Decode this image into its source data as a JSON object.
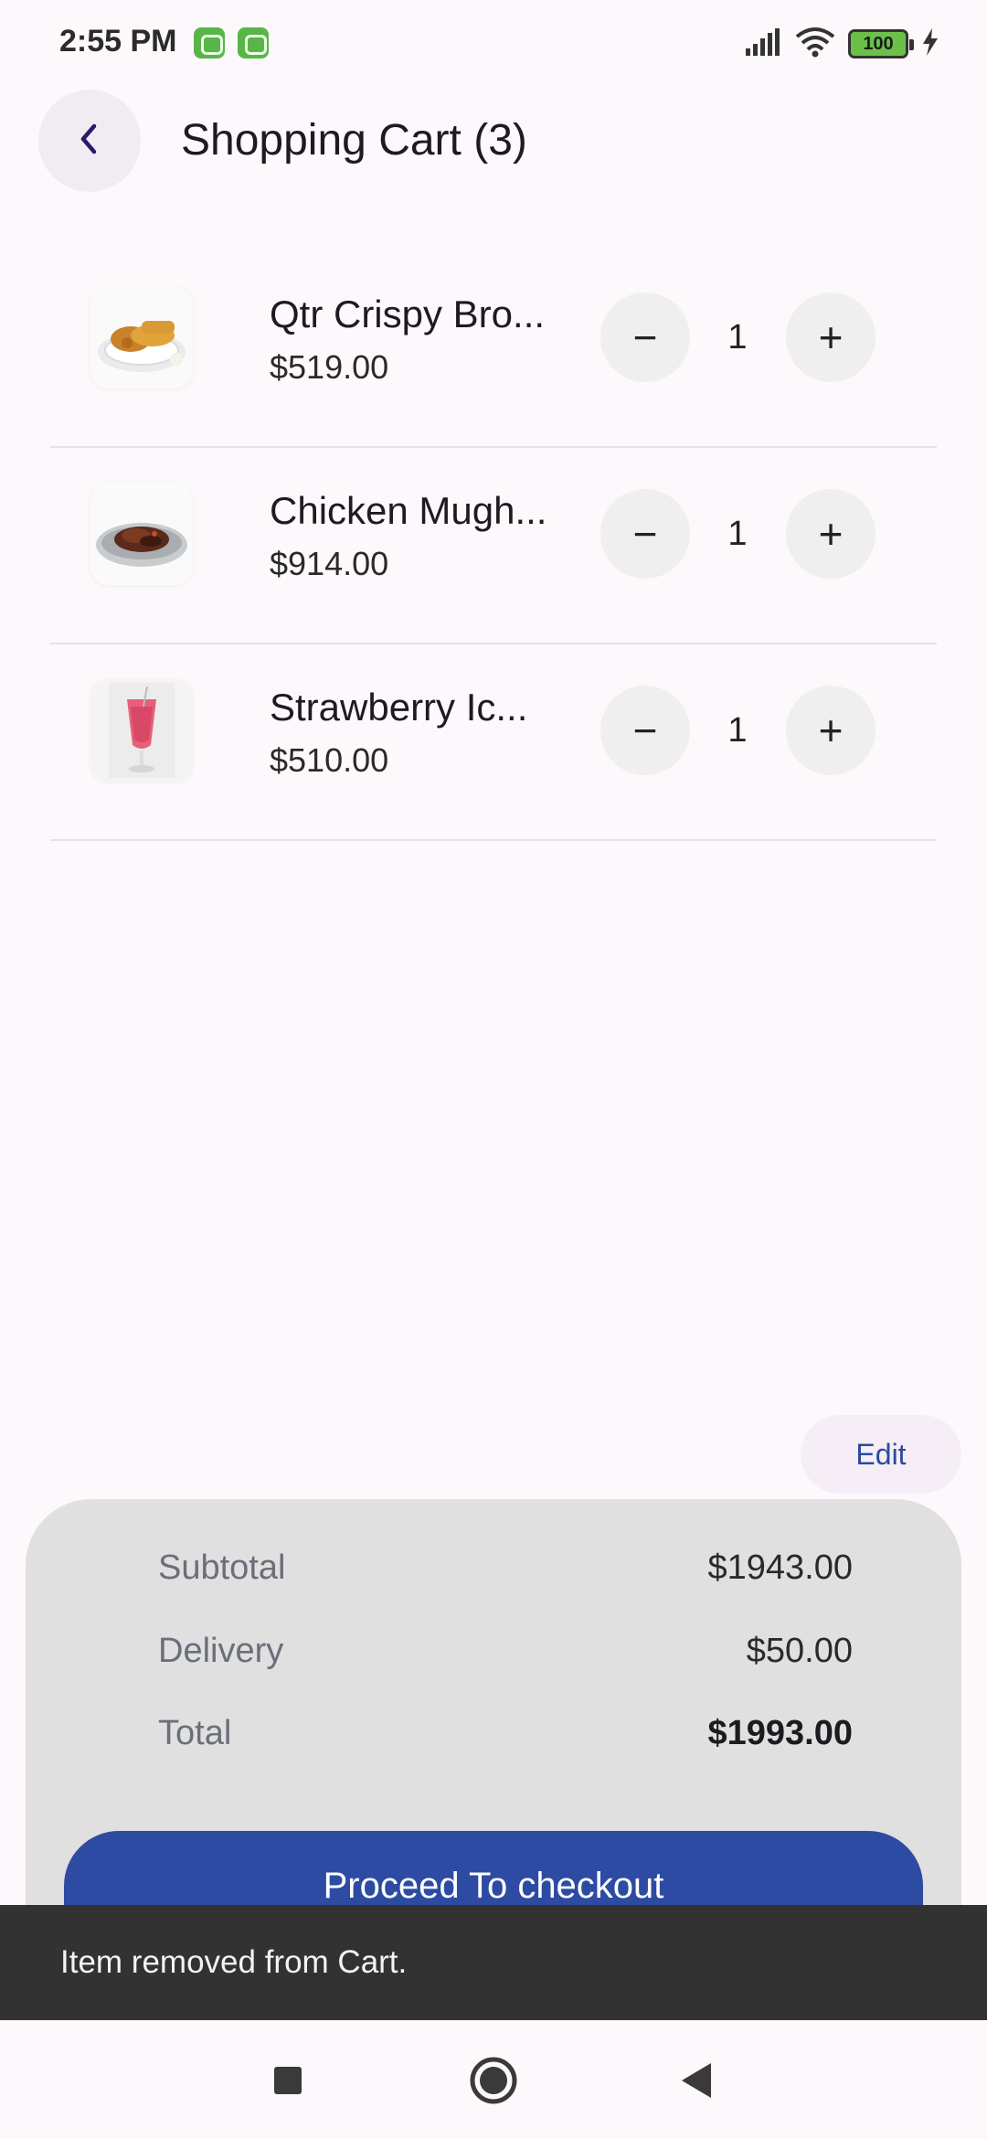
{
  "status_bar": {
    "time": "2:55 PM",
    "battery_level": "100",
    "icons": [
      "notification-app-icon",
      "notification-app-icon",
      "signal-icon",
      "wifi-icon",
      "battery-icon",
      "charging-icon"
    ]
  },
  "header": {
    "title": "Shopping Cart (3)",
    "back_icon": "chevron-left-icon"
  },
  "cart": {
    "items": [
      {
        "name": "Qtr Crispy Bro...",
        "price": "$519.00",
        "quantity": "1",
        "minus_label": "−",
        "plus_label": "+",
        "image": "fried-chicken-plate"
      },
      {
        "name": "Chicken Mugh...",
        "price": "$914.00",
        "quantity": "1",
        "minus_label": "−",
        "plus_label": "+",
        "image": "chicken-foil-platter"
      },
      {
        "name": "Strawberry Ic...",
        "price": "$510.00",
        "quantity": "1",
        "minus_label": "−",
        "plus_label": "+",
        "image": "strawberry-ice-drink"
      }
    ]
  },
  "edit_label": "Edit",
  "summary": {
    "subtotal_label": "Subtotal",
    "subtotal_value": "$1943.00",
    "delivery_label": "Delivery",
    "delivery_value": "$50.00",
    "total_label": "Total",
    "total_value": "$1993.00",
    "checkout_label": "Proceed To checkout"
  },
  "snackbar": {
    "message": "Item removed from Cart."
  },
  "nav_bar": {
    "icons": [
      "recents-square-icon",
      "home-circle-icon",
      "back-triangle-icon"
    ]
  },
  "colors": {
    "accent": "#2d4ba2",
    "background": "#fdf8fc",
    "summary_panel": "#e0e0e0",
    "snackbar": "#323233",
    "back_chevron": "#2a1a6e"
  }
}
